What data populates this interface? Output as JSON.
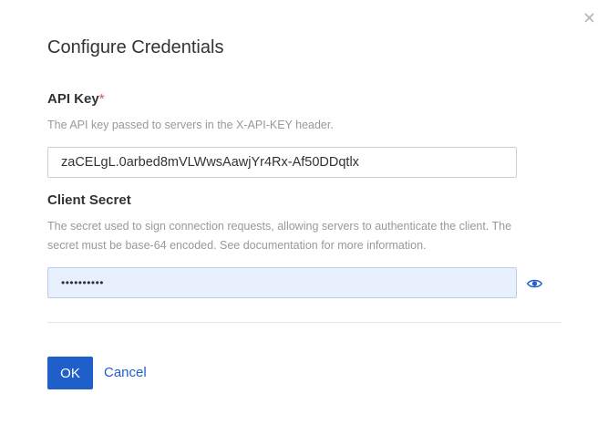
{
  "dialog": {
    "title": "Configure Credentials",
    "close_icon": "close-icon"
  },
  "api_key": {
    "label": "API Key",
    "required_mark": "*",
    "help": "The API key passed to servers in the X-API-KEY header.",
    "value": "zaCELgL.0arbed8mVLWwsAawjYr4Rx-Af50DDqtlx"
  },
  "client_secret": {
    "label": "Client Secret",
    "help_line1": "The secret used to sign connection requests, allowing servers to authenticate the client. The",
    "help_line2": "secret must be base-64 encoded. See documentation for more information.",
    "masked_value": "••••••••••",
    "reveal_icon": "eye-icon"
  },
  "actions": {
    "ok_label": "OK",
    "cancel_label": "Cancel"
  },
  "colors": {
    "primary": "#1f5fc9",
    "required": "#d9534f",
    "focused_field_bg": "#e8f0fe"
  }
}
